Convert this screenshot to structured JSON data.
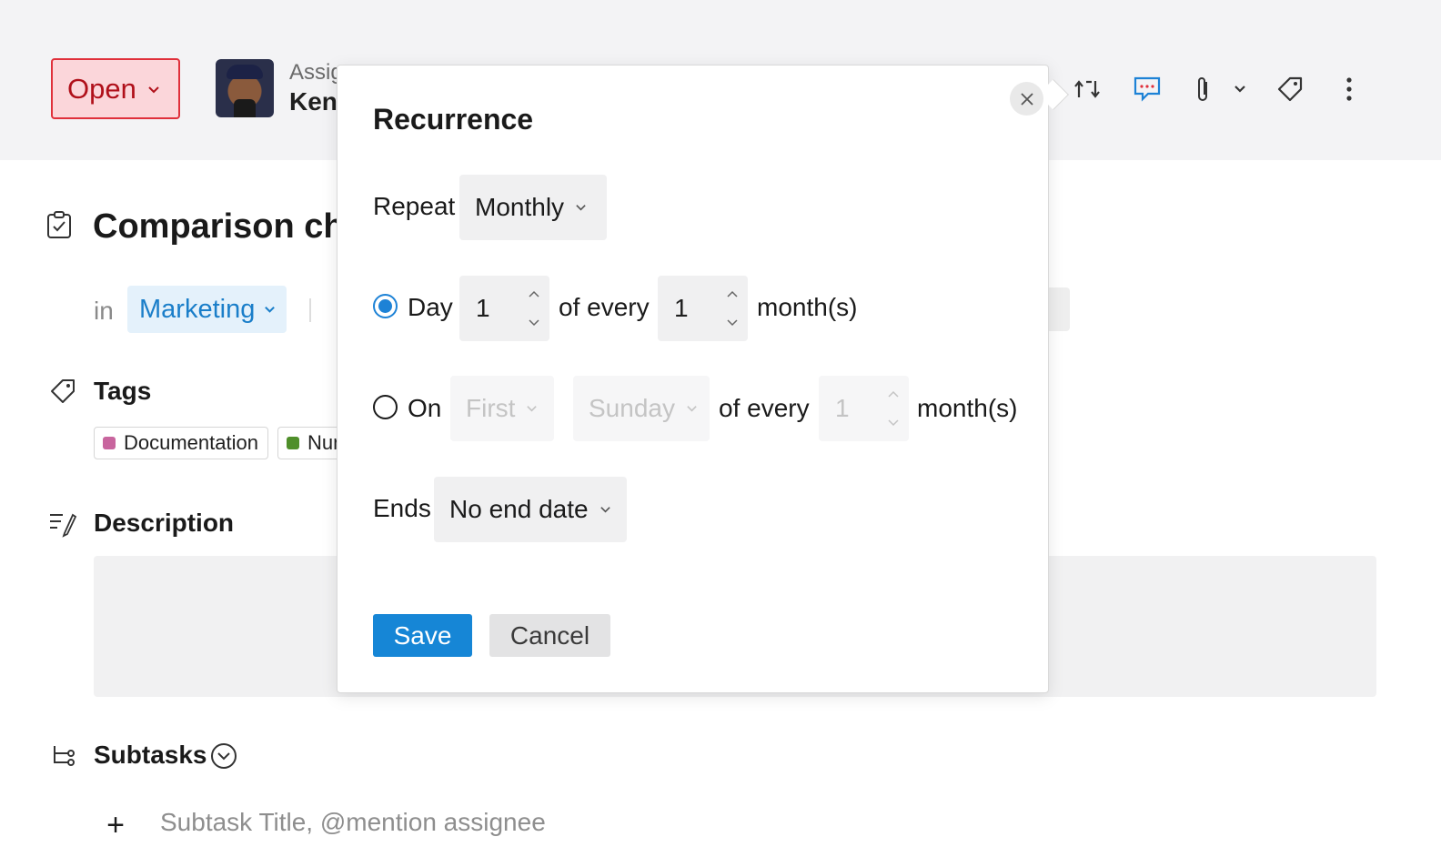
{
  "header": {
    "status_label": "Open",
    "assignee_label": "Assignee",
    "assignee_name": "Ken",
    "toolbar_icons": [
      "recurrence-icon",
      "comments-icon",
      "attachment-icon",
      "chevron-down-icon",
      "tag-icon",
      "more-icon"
    ]
  },
  "task": {
    "title": "Comparison chart",
    "in_label": "in",
    "project": "Marketing"
  },
  "tags": {
    "label": "Tags",
    "items": [
      {
        "name": "Documentation",
        "color": "#c8659e"
      },
      {
        "name": "Numbers",
        "color": "#4f8f2a"
      }
    ]
  },
  "description": {
    "label": "Description"
  },
  "subtasks": {
    "label": "Subtasks",
    "placeholder": "Subtask Title, @mention assignee"
  },
  "recurrence": {
    "title": "Recurrence",
    "repeat_label": "Repeat",
    "repeat_value": "Monthly",
    "day_option": {
      "selected": true,
      "label": "Day",
      "day_value": "1",
      "of_every_label": "of every",
      "interval_value": "1",
      "unit_label": "month(s)"
    },
    "on_option": {
      "selected": false,
      "label": "On",
      "ordinal_value": "First",
      "weekday_value": "Sunday",
      "of_every_label": "of every",
      "interval_value": "1",
      "unit_label": "month(s)"
    },
    "ends_label": "Ends",
    "ends_value": "No end date",
    "save_label": "Save",
    "cancel_label": "Cancel"
  },
  "colors": {
    "accent": "#1686d6",
    "status_bg": "#fbd6da",
    "status_border": "#e0303b",
    "project_bg": "#e4f1fb"
  }
}
